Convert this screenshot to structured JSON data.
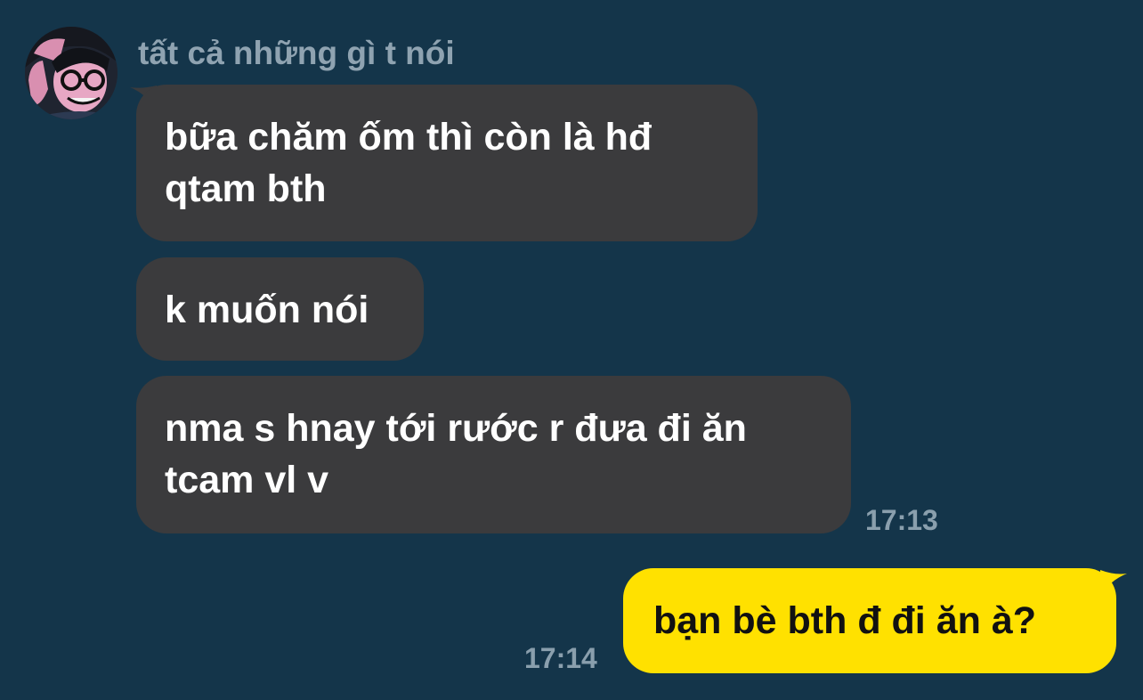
{
  "conversation": {
    "sender": {
      "name": "tất cả những gì t nói",
      "avatar_icon": "avatar-icon"
    },
    "incoming_messages": [
      {
        "text": "bữa chăm ốm thì còn là hđ\nqtam bth"
      },
      {
        "text": "k muốn nói"
      },
      {
        "text": "nma s hnay tới rước r đưa đi ăn\ntcam vl v"
      }
    ],
    "incoming_time": "17:13",
    "outgoing_messages": [
      {
        "text": "bạn bè bth đ đi ăn à?"
      }
    ],
    "outgoing_time": "17:14"
  },
  "colors": {
    "background": "#14354a",
    "incoming_bubble": "#3b3b3d",
    "outgoing_bubble": "#ffe100",
    "timestamp": "#8a9fad",
    "sender_name": "#8fa3b1"
  }
}
